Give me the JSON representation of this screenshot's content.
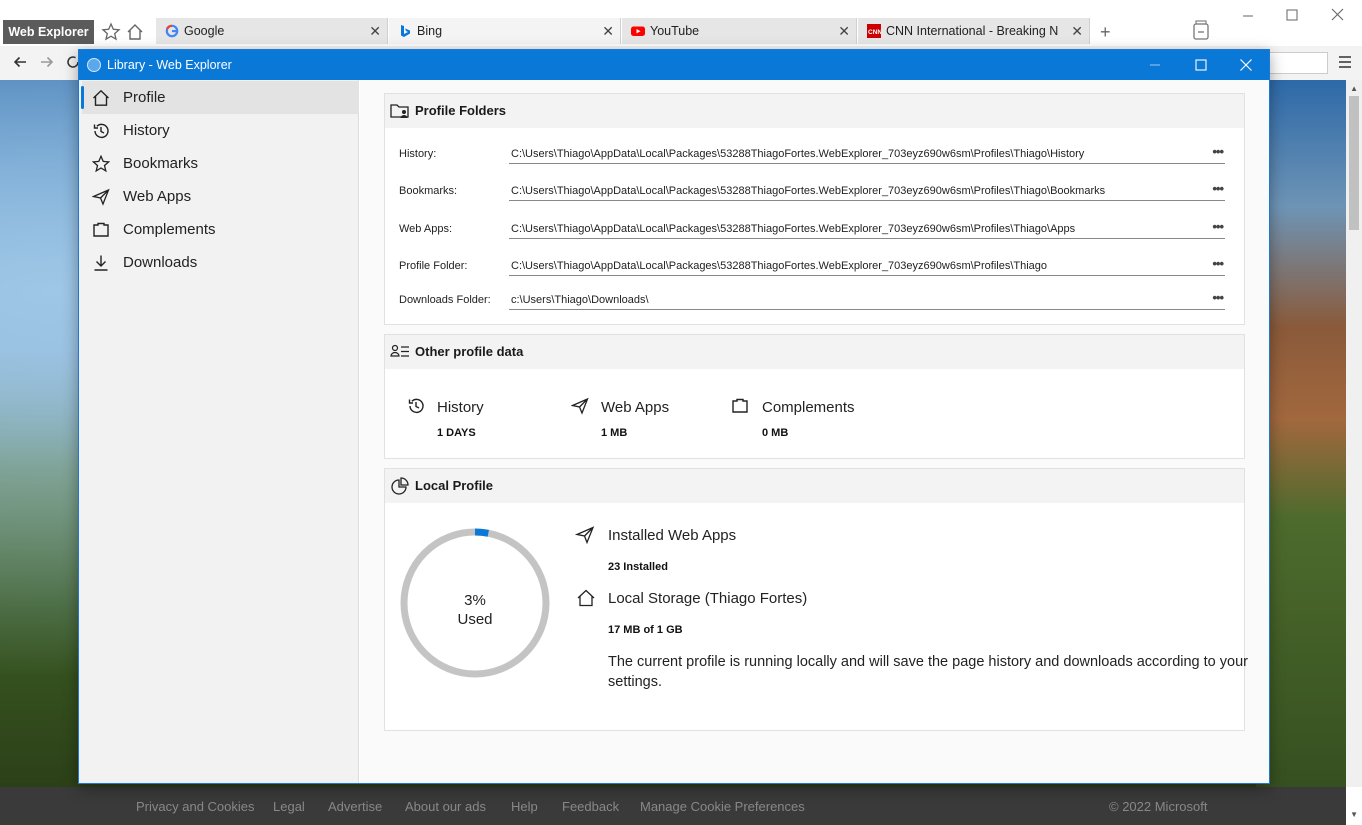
{
  "browser": {
    "brand": "Web Explorer",
    "tabs": [
      {
        "title": "Google",
        "icon": "google-favicon",
        "active": false
      },
      {
        "title": "Bing",
        "icon": "bing-favicon",
        "active": true
      },
      {
        "title": "YouTube",
        "icon": "youtube-favicon",
        "active": false
      },
      {
        "title": "CNN International - Breaking News",
        "icon": "cnn-favicon",
        "active": false
      }
    ],
    "close_glyph": "✕",
    "new_tab_glyph": "+"
  },
  "page_footer": {
    "links": [
      "Privacy and Cookies",
      "Legal",
      "Advertise",
      "About our ads",
      "Help",
      "Feedback",
      "Manage Cookie Preferences"
    ],
    "copyright": "© 2022 Microsoft"
  },
  "library": {
    "title": "Library - Web Explorer",
    "accent": "#0a78d7",
    "sidebar": {
      "items": [
        {
          "label": "Profile",
          "icon": "home-icon",
          "active": true
        },
        {
          "label": "History",
          "icon": "history-icon",
          "active": false
        },
        {
          "label": "Bookmarks",
          "icon": "star-icon",
          "active": false
        },
        {
          "label": "Web Apps",
          "icon": "send-icon",
          "active": false
        },
        {
          "label": "Complements",
          "icon": "complements-icon",
          "active": false
        },
        {
          "label": "Downloads",
          "icon": "download-icon",
          "active": false
        }
      ]
    },
    "profile_folders": {
      "heading": "Profile Folders",
      "rows": [
        {
          "label": "History:",
          "value": "C:\\Users\\Thiago\\AppData\\Local\\Packages\\53288ThiagoFortes.WebExplorer_703eyz690w6sm\\Profiles\\Thiago\\History"
        },
        {
          "label": "Bookmarks:",
          "value": "C:\\Users\\Thiago\\AppData\\Local\\Packages\\53288ThiagoFortes.WebExplorer_703eyz690w6sm\\Profiles\\Thiago\\Bookmarks"
        },
        {
          "label": "Web Apps:",
          "value": "C:\\Users\\Thiago\\AppData\\Local\\Packages\\53288ThiagoFortes.WebExplorer_703eyz690w6sm\\Profiles\\Thiago\\Apps"
        },
        {
          "label": "Profile Folder:",
          "value": "C:\\Users\\Thiago\\AppData\\Local\\Packages\\53288ThiagoFortes.WebExplorer_703eyz690w6sm\\Profiles\\Thiago"
        },
        {
          "label": "Downloads Folder:",
          "value": "c:\\Users\\Thiago\\Downloads\\"
        }
      ],
      "more_glyph": "•••"
    },
    "other_profile_data": {
      "heading": "Other profile data",
      "stats": [
        {
          "label": "History",
          "value": "1 DAYS",
          "icon": "history-icon"
        },
        {
          "label": "Web Apps",
          "value": "1 MB",
          "icon": "send-icon"
        },
        {
          "label": "Complements",
          "value": "0 MB",
          "icon": "complements-icon"
        }
      ]
    },
    "local_profile": {
      "heading": "Local Profile",
      "used_percent": 3,
      "used_text": "3%",
      "used_label": "Used",
      "installed_label": "Installed Web Apps",
      "installed_value": "23 Installed",
      "storage_label": "Local Storage (Thiago Fortes)",
      "storage_value": "17 MB of 1 GB",
      "description": "The current profile is running locally and will save the page history and downloads according to your settings."
    }
  }
}
